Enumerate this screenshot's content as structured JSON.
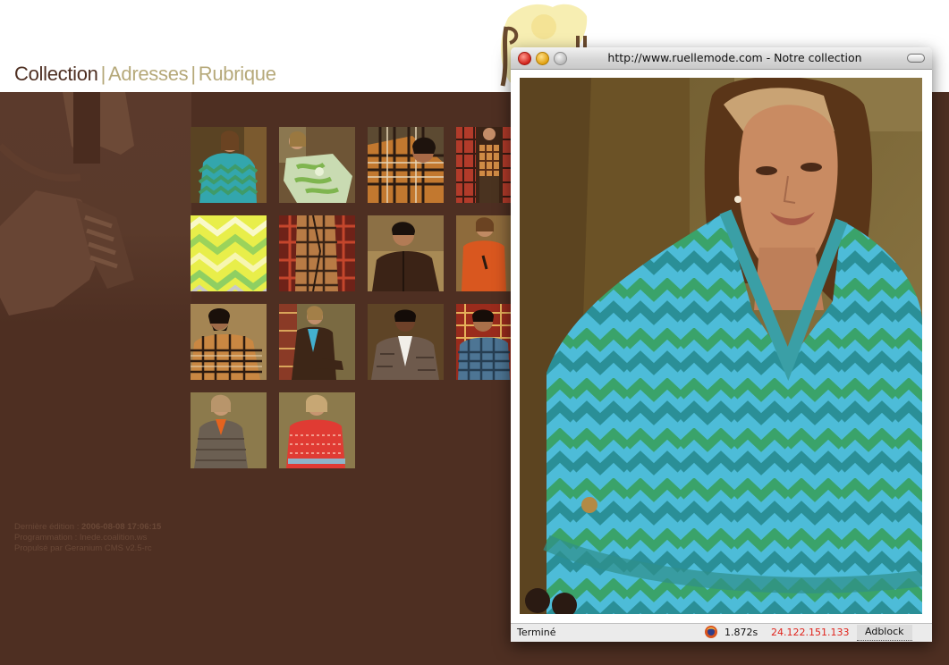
{
  "nav": {
    "items": [
      {
        "label": "Collection",
        "active": true
      },
      {
        "label": "Adresses",
        "active": false
      },
      {
        "label": "Rubrique",
        "active": false
      }
    ],
    "separator": "|"
  },
  "thumbnails": [
    {
      "name": "thumb-model-zigzag-sweater",
      "icon": "photo-thumbnail"
    },
    {
      "name": "thumb-model-green-print",
      "icon": "photo-thumbnail"
    },
    {
      "name": "thumb-man-plaid-lying",
      "icon": "photo-thumbnail"
    },
    {
      "name": "thumb-model-plaid-vest",
      "icon": "photo-thumbnail"
    },
    {
      "name": "thumb-yellow-zigzag-fabric",
      "icon": "photo-thumbnail"
    },
    {
      "name": "thumb-plaid-jacket-detail",
      "icon": "photo-thumbnail"
    },
    {
      "name": "thumb-man-brown-shirt",
      "icon": "photo-thumbnail"
    },
    {
      "name": "thumb-model-orange-top",
      "icon": "photo-thumbnail"
    },
    {
      "name": "thumb-man-plaid-sweater",
      "icon": "photo-thumbnail"
    },
    {
      "name": "thumb-model-brown-coat",
      "icon": "photo-thumbnail"
    },
    {
      "name": "thumb-man-tweed-jacket",
      "icon": "photo-thumbnail"
    },
    {
      "name": "thumb-man-checked-shirt",
      "icon": "photo-thumbnail"
    },
    {
      "name": "thumb-model-tweed-jacket",
      "icon": "photo-thumbnail"
    },
    {
      "name": "thumb-model-red-sweater",
      "icon": "photo-thumbnail"
    }
  ],
  "footer": {
    "edited_label": "Dernière édition :",
    "edited_value": "2006-08-08 17:06:15",
    "programming": "Programmation : Inede.coalition.ws",
    "powered": "Propulsé par Geranium CMS v2.5-rc"
  },
  "popup": {
    "title": "http://www.ruellemode.com - Notre collection",
    "status": {
      "text": "Terminé",
      "time": "1.872s",
      "ip": "24.122.151.133",
      "adblock": "Adblock"
    }
  },
  "colors": {
    "background": "#4e2f22",
    "nav_active": "#4e2f22",
    "nav_inactive": "#b6a97a",
    "status_ip": "#e0231b"
  }
}
